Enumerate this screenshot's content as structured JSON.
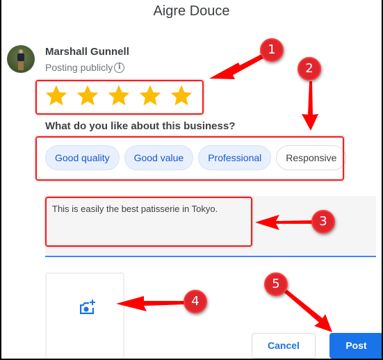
{
  "dialog": {
    "title": "Aigre Douce"
  },
  "user": {
    "name": "Marshall Gunnell",
    "posting_status": "Posting publicly",
    "info_icon": "info-icon",
    "avatar_icon": "avatar"
  },
  "rating": {
    "value": 5,
    "max": 5,
    "star_color": "#fbbc04"
  },
  "question": {
    "label": "What do you like about this business?",
    "chips": [
      {
        "label": "Good quality",
        "selected": true
      },
      {
        "label": "Good value",
        "selected": true
      },
      {
        "label": "Professional",
        "selected": true
      },
      {
        "label": "Responsive",
        "selected": false
      }
    ]
  },
  "review": {
    "text": "This is easily the best patisserie in Tokyo."
  },
  "photo": {
    "icon": "add-photo-icon"
  },
  "actions": {
    "cancel_label": "Cancel",
    "post_label": "Post"
  },
  "annotations": {
    "badges": [
      "1",
      "2",
      "3",
      "4",
      "5"
    ],
    "color": "#ff1a1a"
  },
  "colors": {
    "accent": "#1a73e8",
    "chip_selected_bg": "#e8f0fe",
    "chip_selected_text": "#1a56c9",
    "input_underline": "#4285f4"
  }
}
